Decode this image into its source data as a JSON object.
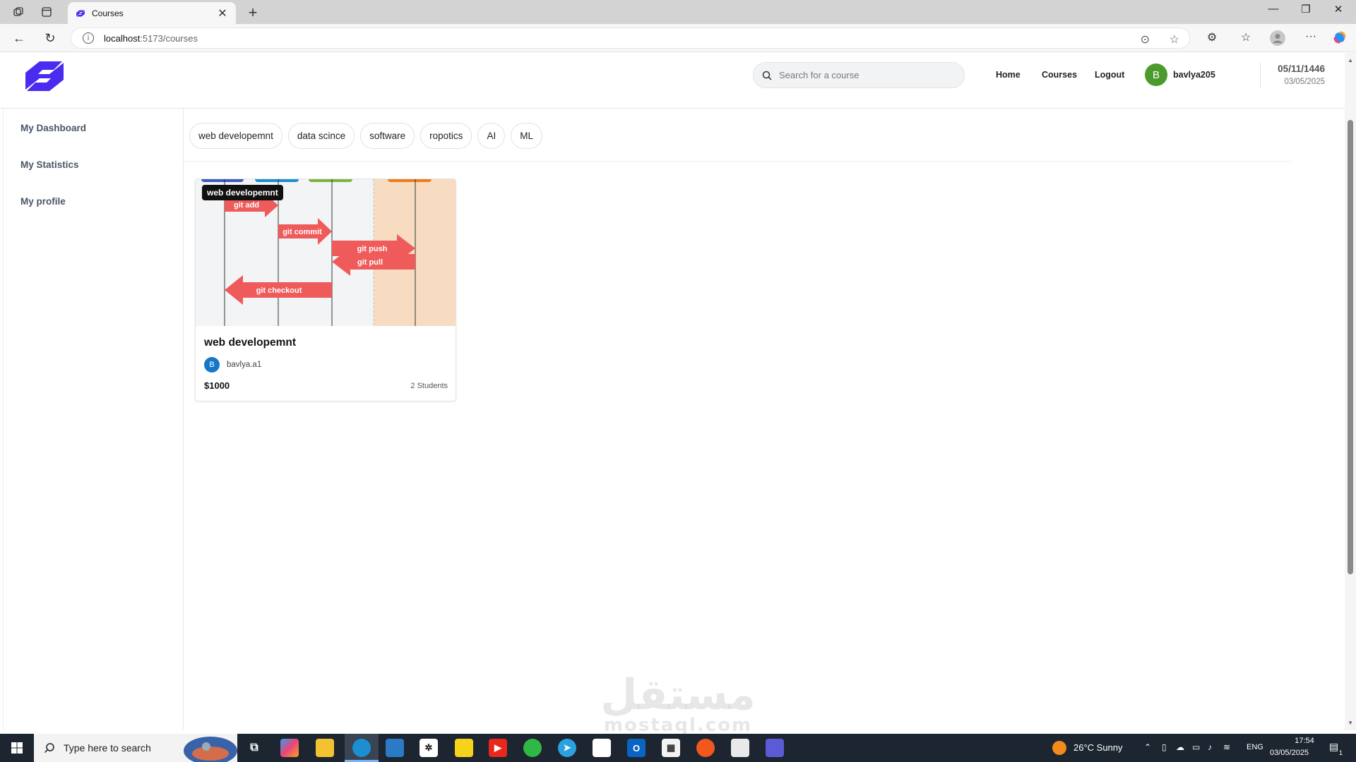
{
  "browser": {
    "tab_title": "Courses",
    "url_host": "localhost",
    "url_path": ":5173/courses"
  },
  "header": {
    "search_placeholder": "Search for a course",
    "nav": [
      "Home",
      "Courses",
      "Logout"
    ],
    "user_initial": "B",
    "username": "bavlya205",
    "date_hijri": "05/11/1446",
    "date_gregorian": "03/05/2025"
  },
  "sidebar": {
    "items": [
      "My Dashboard",
      "My Statistics",
      "My profile"
    ]
  },
  "categories": [
    "web developemnt",
    "data scince",
    "software",
    "ropotics",
    "AI",
    "ML"
  ],
  "course_card": {
    "tooltip": "web developemnt",
    "title": "web developemnt",
    "instructor_initial": "B",
    "instructor": "bavlya.a1",
    "price": "$1000",
    "students": "2 Students",
    "thumbnail_labels": [
      "git add",
      "git commit",
      "git push",
      "git pull",
      "git checkout"
    ]
  },
  "watermark": {
    "arabic": "مستقل",
    "latin": "mostaql.com"
  },
  "taskbar": {
    "search_placeholder": "Type here to search",
    "weather": "26°C  Sunny",
    "language": "ENG",
    "time": "17:54",
    "date": "03/05/2025",
    "notifications": "1"
  },
  "colors": {
    "brand": "#4a2cf0",
    "arrow": "#ef5b5b",
    "avatar_user": "#4a9a2c",
    "avatar_instructor": "#1677c9"
  }
}
